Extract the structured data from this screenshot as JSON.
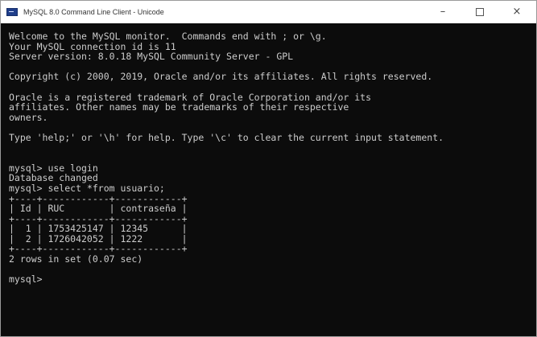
{
  "window": {
    "title": "MySQL 8.0 Command Line Client - Unicode",
    "minimize": "–",
    "close": "×"
  },
  "console": {
    "lines": [
      "Welcome to the MySQL monitor.  Commands end with ; or \\g.",
      "Your MySQL connection id is 11",
      "Server version: 8.0.18 MySQL Community Server - GPL",
      "",
      "Copyright (c) 2000, 2019, Oracle and/or its affiliates. All rights reserved.",
      "",
      "Oracle is a registered trademark of Oracle Corporation and/or its",
      "affiliates. Other names may be trademarks of their respective",
      "owners.",
      "",
      "Type 'help;' or '\\h' for help. Type '\\c' to clear the current input statement.",
      "",
      "",
      "mysql> use login",
      "Database changed",
      "mysql> select *from usuario;",
      "+----+------------+------------+",
      "| Id | RUC        | contraseña |",
      "+----+------------+------------+",
      "|  1 | 1753425147 | 12345      |",
      "|  2 | 1726042052 | 1222       |",
      "+----+------------+------------+",
      "2 rows in set (0.07 sec)",
      "",
      "mysql>"
    ]
  },
  "colors": {
    "console_bg": "#0c0c0c",
    "console_fg": "#cccccc",
    "titlebar_bg": "#ffffff"
  }
}
